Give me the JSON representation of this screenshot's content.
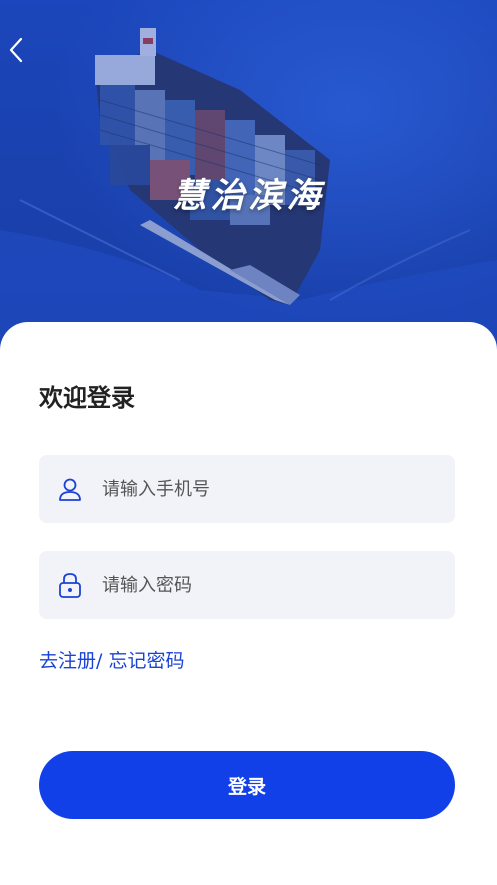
{
  "hero": {
    "brand_title": "慧治滨海"
  },
  "login": {
    "welcome": "欢迎登录",
    "phone_placeholder": "请输入手机号",
    "password_placeholder": "请输入密码",
    "register_link": "去注册/",
    "forgot_link": " 忘记密码",
    "submit_label": "登录"
  },
  "colors": {
    "accent": "#1240e8",
    "link": "#1a43d6",
    "field_bg": "#f2f3f8"
  },
  "icons": [
    "chevron-left-icon",
    "user-icon",
    "lock-icon"
  ]
}
